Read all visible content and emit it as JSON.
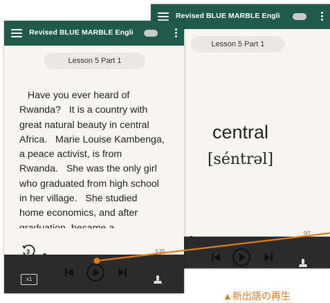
{
  "colors": {
    "appbar": "#1f5a4b",
    "screen_bg": "#f6f5ef",
    "bottom_bar": "#2b2b2b",
    "accent_orange": "#e07a1a"
  },
  "app": {
    "title": "Revised BLUE MARBLE Engli"
  },
  "lesson": {
    "label": "Lesson 5 Part 1"
  },
  "reading_screen": {
    "lines": [
      "   Have you ever heard of",
      "Rwanda?   It is a country with",
      "great natural beauty in central",
      "Africa.   Marie Louise Kambenga,",
      "a peace activist, is from",
      "Rwanda.   She was the only girl",
      "who graduated from high school",
      "in her village.   She studied",
      "home economics, and after",
      "graduation, became a"
    ],
    "time_total": "1:20",
    "rewind_seconds": "3",
    "speed": "x1"
  },
  "vocab_screen": {
    "word": "central",
    "phonetic": "[séntrəl]",
    "counter": "0/7"
  },
  "icons": {
    "menu": "hamburger-icon",
    "more": "kebab-icon",
    "previous": "skip-previous-icon",
    "play": "play-circle-icon",
    "next": "skip-next-icon",
    "rewind": "rewind-3-icon",
    "reader": "reader-mode-icon"
  },
  "annotation": {
    "text": "▲新出語の再生"
  }
}
